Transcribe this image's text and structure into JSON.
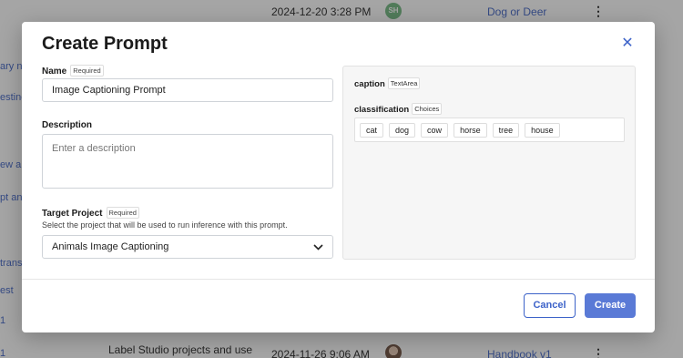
{
  "background": {
    "rows": [
      {
        "datetime": "2024-12-20 3:28 PM",
        "avatar_initials": "SH",
        "link": "Dog or Deer"
      },
      {
        "description": "Label Studio projects and use",
        "datetime": "2024-11-26 9:06 AM",
        "link": "Handbook v1"
      }
    ],
    "left_links": [
      "ary n",
      "esting",
      "ew an",
      "pt ana",
      "trans",
      "est",
      "1",
      "1"
    ]
  },
  "modal": {
    "title": "Create Prompt",
    "name_label": "Name",
    "required_badge": "Required",
    "name_value": "Image Captioning Prompt",
    "description_label": "Description",
    "description_placeholder": "Enter a description",
    "target_label": "Target Project",
    "target_helper": "Select the project that will be used to run inference with this prompt.",
    "target_value": "Animals Image Captioning",
    "preview": {
      "caption_label": "caption",
      "caption_tag": "TextArea",
      "classification_label": "classification",
      "classification_tag": "Choices",
      "choices": [
        "cat",
        "dog",
        "cow",
        "horse",
        "tree",
        "house"
      ]
    },
    "cancel_label": "Cancel",
    "create_label": "Create"
  },
  "colors": {
    "accent": "#3d63c9",
    "primary_button": "#5a7ad6",
    "overlay": "#282828"
  }
}
